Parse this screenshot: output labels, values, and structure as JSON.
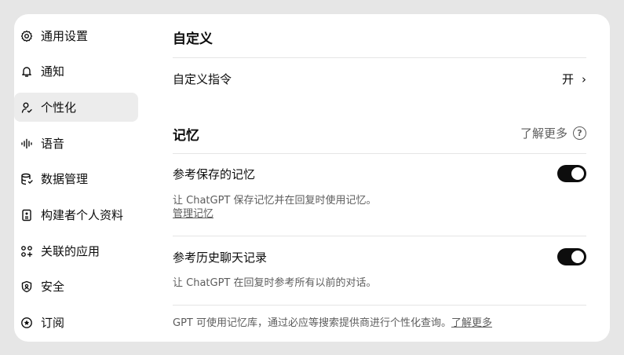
{
  "sidebar": {
    "items": [
      {
        "label": "通用设置",
        "icon": "gear-icon"
      },
      {
        "label": "通知",
        "icon": "bell-icon"
      },
      {
        "label": "个性化",
        "icon": "person-icon",
        "active": true
      },
      {
        "label": "语音",
        "icon": "waveform-icon"
      },
      {
        "label": "数据管理",
        "icon": "database-icon"
      },
      {
        "label": "构建者个人资料",
        "icon": "profile-card-icon"
      },
      {
        "label": "关联的应用",
        "icon": "apps-icon"
      },
      {
        "label": "安全",
        "icon": "shield-icon"
      },
      {
        "label": "订阅",
        "icon": "subscription-icon"
      }
    ]
  },
  "custom": {
    "heading": "自定义",
    "instructions_label": "自定义指令",
    "instructions_value": "开"
  },
  "memory": {
    "heading": "记忆",
    "learn_more": "了解更多",
    "saved": {
      "label": "参考保存的记忆",
      "on": true,
      "description": "让 ChatGPT 保存记忆并在回复时使用记忆。",
      "manage_link": "管理记忆"
    },
    "history": {
      "label": "参考历史聊天记录",
      "on": true,
      "description": "让 ChatGPT 在回复时参考所有以前的对话。"
    },
    "footer_text": "GPT 可使用记忆库，通过必应等搜索提供商进行个性化查询。",
    "footer_link": "了解更多"
  },
  "colors": {
    "background": "#e6e6e6",
    "active_item": "#ececec",
    "toggle_on": "#0d0d0d"
  }
}
